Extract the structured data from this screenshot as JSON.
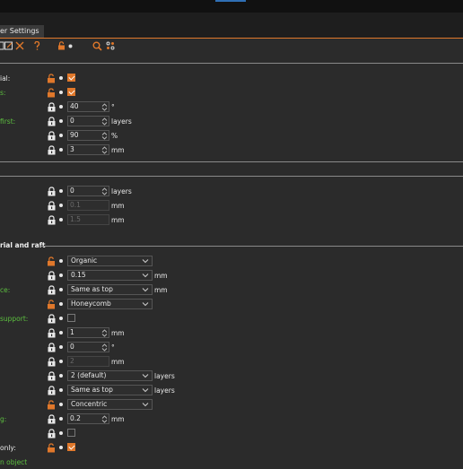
{
  "tab": {
    "label": "er Settings"
  },
  "toolbar": {
    "icons": [
      "copy-icon",
      "edit-icon",
      "close-icon",
      "help-icon",
      "unlock-icon",
      "search-icon",
      "settings-icon"
    ]
  },
  "colors": {
    "accent": "#e0782b",
    "green_label": "#5cbf3f",
    "background": "#2b2b2b"
  },
  "section1": {
    "rows": [
      {
        "label": "ial:",
        "lock": "unlocked",
        "control": "checkbox",
        "checked": true
      },
      {
        "label": "s:",
        "lock": "unlocked",
        "control": "checkbox",
        "checked": true,
        "green": true
      },
      {
        "label": "",
        "lock": "locked",
        "value": "40",
        "unit": "°"
      },
      {
        "label": "first:",
        "lock": "locked",
        "value": "0",
        "unit": "layers",
        "green": true
      },
      {
        "label": "",
        "lock": "locked",
        "value": "90",
        "unit": "%"
      },
      {
        "label": "",
        "lock": "locked",
        "value": "3",
        "unit": "mm"
      }
    ]
  },
  "section2": {
    "rows": [
      {
        "lock": "locked",
        "value": "0",
        "unit": "layers"
      },
      {
        "lock": "locked",
        "value": "0.1",
        "unit": "mm",
        "disabled": true
      },
      {
        "lock": "locked",
        "value": "1.5",
        "unit": "mm",
        "disabled": true
      }
    ]
  },
  "section3": {
    "title": "rial and raft",
    "rows": [
      {
        "label": "",
        "lock": "unlocked",
        "dropdown": "Organic"
      },
      {
        "label": "",
        "lock": "locked",
        "dropdown": "0.15",
        "unit": "mm"
      },
      {
        "label": "ce:",
        "lock": "locked",
        "dropdown": "Same as top",
        "unit": "mm",
        "green": true
      },
      {
        "label": "",
        "lock": "unlocked",
        "dropdown": "Honeycomb"
      },
      {
        "label": "support:",
        "lock": "locked",
        "control": "checkbox",
        "checked": false,
        "green": true
      },
      {
        "label": "",
        "lock": "locked",
        "value": "1",
        "unit": "mm"
      },
      {
        "label": "",
        "lock": "locked",
        "value": "0",
        "unit": "°"
      },
      {
        "label": "",
        "lock": "locked",
        "value": "2",
        "unit": "mm",
        "disabled": true
      },
      {
        "label": "",
        "lock": "locked",
        "dropdown": "2 (default)",
        "unit": "layers"
      },
      {
        "label": "",
        "lock": "locked",
        "dropdown": "Same as top",
        "unit": "layers"
      },
      {
        "label": "",
        "lock": "unlocked",
        "dropdown": "Concentric"
      },
      {
        "label": "g:",
        "lock": "locked",
        "value": "0.2",
        "unit": "mm",
        "green": true
      },
      {
        "label": "",
        "lock": "locked",
        "control": "checkbox",
        "checked": false
      },
      {
        "label": "only:",
        "lock": "unlocked",
        "control": "checkbox",
        "checked": true
      },
      {
        "label": "n object",
        "lock": "",
        "green": true
      }
    ]
  }
}
